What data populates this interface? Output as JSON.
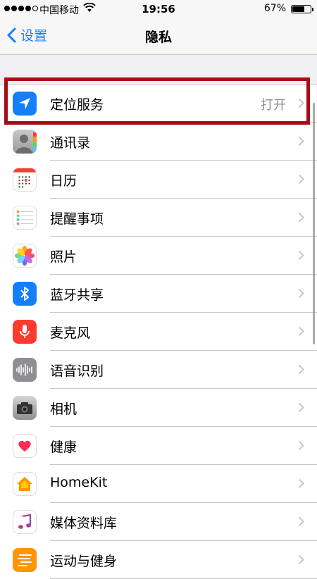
{
  "status_bar": {
    "carrier": "中国移动",
    "time": "19:56",
    "battery": "67%",
    "battery_level": 0.67
  },
  "nav": {
    "back_label": "设置",
    "title": "隐私"
  },
  "rows": [
    {
      "label": "定位服务",
      "value": "打开",
      "icon": "location-arrow-icon",
      "highlighted": true
    },
    {
      "label": "通讯录",
      "icon": "contacts-icon"
    },
    {
      "label": "日历",
      "icon": "calendar-icon"
    },
    {
      "label": "提醒事项",
      "icon": "reminders-icon"
    },
    {
      "label": "照片",
      "icon": "photos-icon"
    },
    {
      "label": "蓝牙共享",
      "icon": "bluetooth-icon"
    },
    {
      "label": "麦克风",
      "icon": "microphone-icon"
    },
    {
      "label": "语音识别",
      "icon": "speech-recognition-icon"
    },
    {
      "label": "相机",
      "icon": "camera-icon"
    },
    {
      "label": "健康",
      "icon": "health-icon"
    },
    {
      "label": "HomeKit",
      "icon": "homekit-icon"
    },
    {
      "label": "媒体资料库",
      "icon": "music-icon"
    },
    {
      "label": "运动与健身",
      "icon": "motion-fitness-icon"
    }
  ],
  "colors": {
    "accent": "#157efb",
    "highlight_border": "#a50d17",
    "background": "#efeff4"
  }
}
